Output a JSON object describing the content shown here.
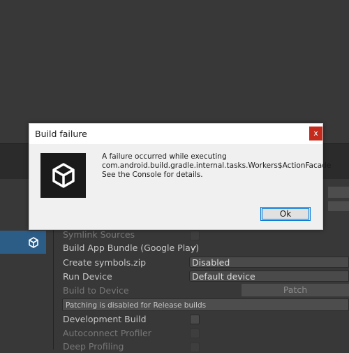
{
  "dialog": {
    "title": "Build failure",
    "close_label": "x",
    "message_lines": [
      "A failure occurred while executing",
      "com.android.build.gradle.internal.tasks.Workers$ActionFacade",
      "See the Console for details."
    ],
    "ok_label": "Ok",
    "logo_icon": "unity-logo-icon"
  },
  "settings": {
    "symlink_sources": "Symlink Sources",
    "build_app_bundle": "Build App Bundle (Google Play)",
    "build_app_bundle_checked": true,
    "create_symbols": "Create symbols.zip",
    "create_symbols_value": "Disabled",
    "run_device": "Run Device",
    "run_device_value": "Default device",
    "build_to_device": "Build to Device",
    "patch_label": "Patch",
    "patching_info": "Patching is disabled for Release builds",
    "development_build": "Development Build",
    "autoconnect_profiler": "Autoconnect Profiler",
    "deep_profiling": "Deep Profiling"
  },
  "colors": {
    "selected_platform": "#2c5d87",
    "close_button": "#c42b1c",
    "ok_border": "#0078d7"
  }
}
